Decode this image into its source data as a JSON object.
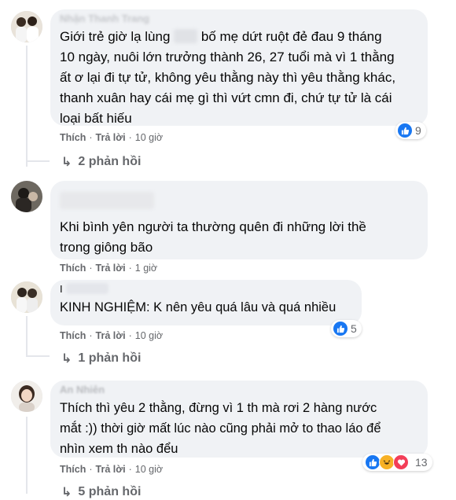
{
  "comments": [
    {
      "author": "Nhận Thanh Trang",
      "text_part1": "Giới trẻ giờ lạ lùng",
      "text_part2": " bố mẹ dứt ruột đẻ đau 9 tháng\n10 ngày, nuôi lớn trưởng thành 26, 27 tuổi mà vì 1 thằng\nất ơ lại đi tự tử, không yêu thằng này thì yêu thằng khác,\nthanh xuân hay cái mẹ gì thì vứt cmn đi, chứ tự tử là cái\nloại bất hiếu",
      "like": "Thích",
      "reply": "Trả lời",
      "time": "10 giờ",
      "reaction_count": "9",
      "replies_label": "2 phản hồi"
    },
    {
      "author": "",
      "text": "Khi bình yên người ta thường quên đi những lời thề\ntrong giông bão",
      "like": "Thích",
      "reply": "Trả lời",
      "time": "1 giờ"
    },
    {
      "author": "I",
      "text": "KINH NGHIỆM: K nên yêu quá lâu và quá nhiều",
      "like": "Thích",
      "reply": "Trả lời",
      "time": "10 giờ",
      "reaction_count": "5",
      "replies_label": "1 phản hồi"
    },
    {
      "author": "An Nhiên",
      "text": "Thích thì yêu 2 thằng, đừng vì 1 th mà rơi 2 hàng nước\nmắt :)) thời giờ mất lúc nào cũng phải mở to thao láo để\nnhìn xem th nào đểu",
      "like": "Thích",
      "reply": "Trả lời",
      "time": "10 giờ",
      "reaction_count": "13",
      "replies_label": "5 phản hồi"
    }
  ],
  "colors": {
    "bubble": "#f0f2f5",
    "meta_text": "#65676b",
    "like_blue": "#1877f2",
    "haha_yellow": "#f7b125",
    "love_red": "#f33e58"
  },
  "icons": {
    "reply_arrow": "↳",
    "like": "like-reaction-icon",
    "haha": "haha-reaction-icon",
    "love": "love-reaction-icon"
  }
}
